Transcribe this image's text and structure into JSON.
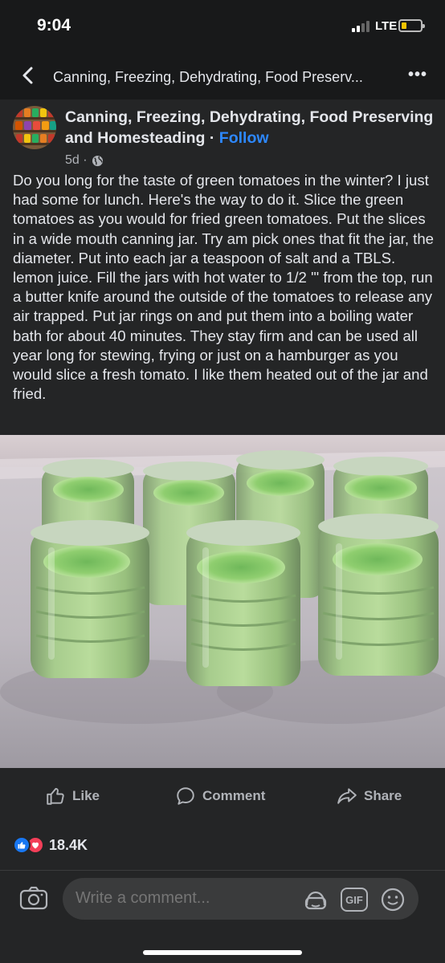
{
  "status_bar": {
    "time": "9:04",
    "network": "LTE"
  },
  "nav": {
    "title": "Canning, Freezing, Dehydrating, Food Preserv..."
  },
  "post": {
    "page_name": "Canning, Freezing, Dehydrating, Food Preserving and Homesteading",
    "separator": " · ",
    "follow_label": "Follow",
    "age": "5d ·",
    "audience_icon": "globe-icon",
    "text": "Do you long for the taste of green tomatoes in the winter? I just had some for lunch. Here's the way to do it. Slice the green tomatoes as you would for fried green tomatoes. Put the slices in a wide mouth canning jar. Try am pick ones that fit the jar, the diameter. Put into each jar a teaspoon of salt and a TBLS. lemon juice. Fill the jars with hot water to 1/2 '\" from the top, run a butter knife around the outside of the tomatoes to release any air trapped. Put jar rings on and put them into a boiling water bath for about 40 minutes. They stay firm and can be used all year long for stewing, frying or just on a hamburger as you would slice a fresh tomato. I like them heated out of the jar and fried."
  },
  "actions": {
    "like": "Like",
    "comment": "Comment",
    "share": "Share"
  },
  "reactions": {
    "count": "18.4K"
  },
  "composer": {
    "placeholder": "Write a comment...",
    "gif_label": "GIF"
  },
  "colors": {
    "background": "#242526",
    "accent": "#2d88ff",
    "text": "#e4e6eb",
    "muted": "#b0b3b8"
  }
}
